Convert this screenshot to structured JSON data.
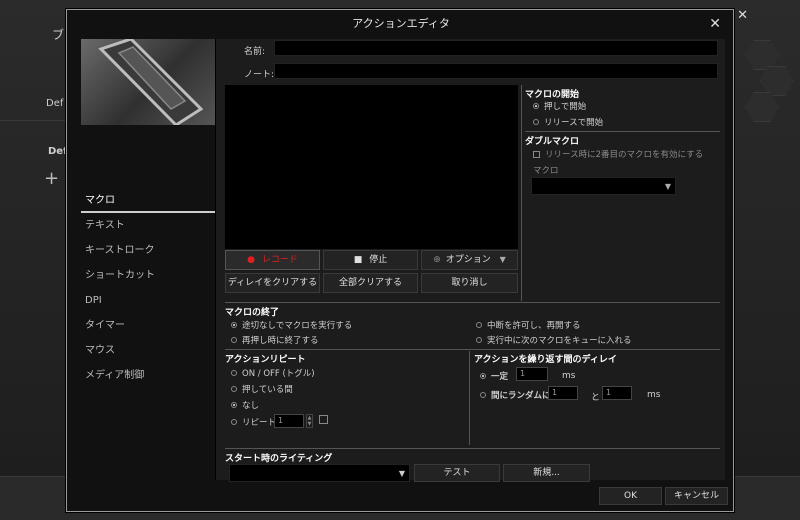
{
  "dialog": {
    "title": "アクションエディタ",
    "close_glyph": "✕"
  },
  "sidebar": {
    "items": [
      {
        "label": "マクロ",
        "active": true
      },
      {
        "label": "テキスト",
        "active": false
      },
      {
        "label": "キーストローク",
        "active": false
      },
      {
        "label": "ショートカット",
        "active": false
      },
      {
        "label": "DPI",
        "active": false
      },
      {
        "label": "タイマー",
        "active": false
      },
      {
        "label": "マウス",
        "active": false
      },
      {
        "label": "メディア制御",
        "active": false
      }
    ]
  },
  "form": {
    "name_label": "名前:",
    "name_value": "",
    "note_label": "ノート:",
    "note_value": ""
  },
  "record_buttons": {
    "record": "レコード",
    "record_glyph": "●",
    "stop": "停止",
    "stop_glyph": "■",
    "options": "オプション",
    "options_glyph": "⊕",
    "options_caret": "▼",
    "clear_delay": "ディレイをクリアする",
    "clear_all": "全部クリアする",
    "undo": "取り消し"
  },
  "macro_start": {
    "heading": "マクロの開始",
    "options": [
      "押しで開始",
      "リリースで開始"
    ],
    "selected": 0
  },
  "double_macro": {
    "heading": "ダブルマクロ",
    "checkbox_label": "リリース時に2番目のマクロを有効にする",
    "macro_label": "マクロ",
    "macro_value": "",
    "caret": "▼"
  },
  "macro_end": {
    "heading": "マクロの終了",
    "options": [
      "途切なしでマクロを実行する",
      "中断を許可し、再開する",
      "再押し時に終了する",
      "実行中に次のマクロをキューに入れる"
    ],
    "selected": 0
  },
  "action_repeat": {
    "heading": "アクションリピート",
    "options": [
      "ON / OFF (トグル)",
      "押している間",
      "なし",
      "リピート"
    ],
    "selected": 2,
    "repeat_value": "1"
  },
  "repeat_delay": {
    "heading": "アクションを繰り返す間のディレイ",
    "fixed_label": "一定",
    "fixed_value": "1",
    "unit": "ms",
    "random_label": "間にランダムに",
    "random_from": "1",
    "and": "と",
    "random_to": "1",
    "unit2": "ms"
  },
  "lighting": {
    "heading": "スタート時のライティング",
    "value": "",
    "caret": "▼",
    "test_label": "テスト",
    "new_label": "新規..."
  },
  "footer": {
    "ok": "OK",
    "cancel": "キャンセル"
  },
  "background": {
    "close_glyph": "✕",
    "text_1": "ブ",
    "text_2": "Def",
    "text_3": "Def",
    "plus_glyph": "+"
  }
}
